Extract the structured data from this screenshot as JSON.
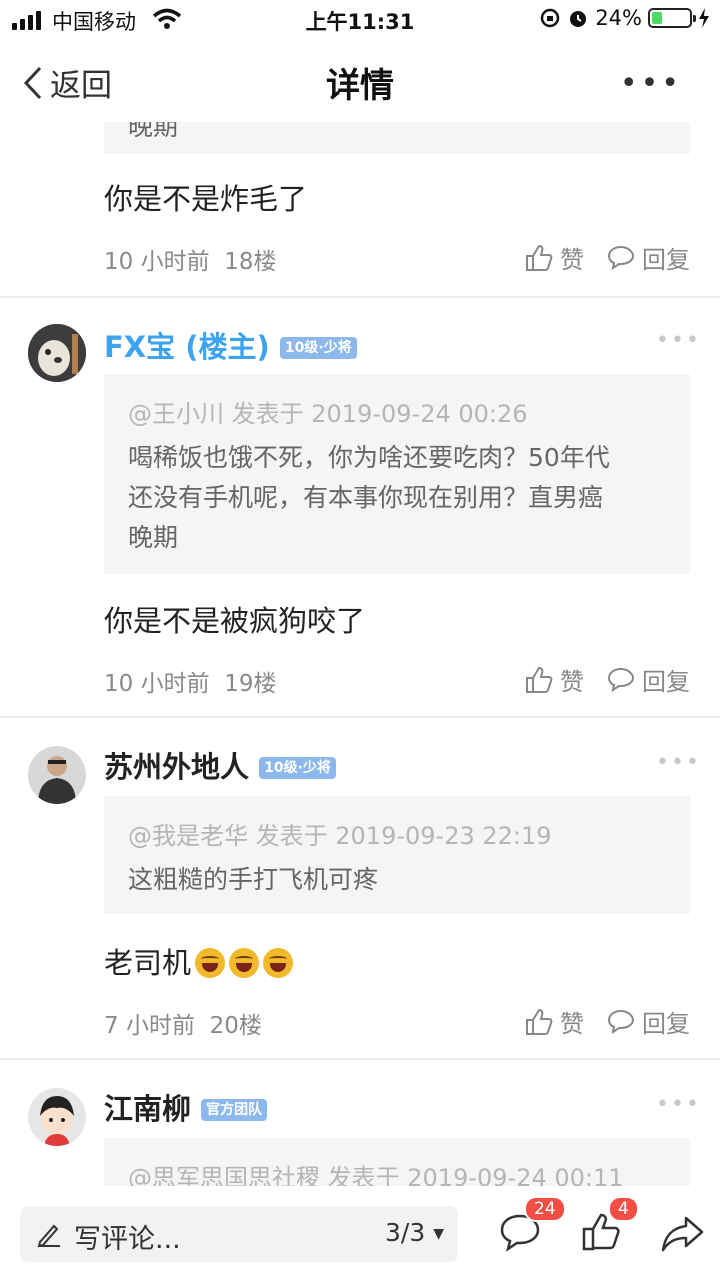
{
  "status": {
    "carrier": "中国移动",
    "time": "上午11:31",
    "battery": "24%"
  },
  "nav": {
    "back": "返回",
    "title": "详情",
    "more": "•••"
  },
  "top_fragment": {
    "quote_tail": "晚期",
    "content": "你是不是炸毛了",
    "time": "10 小时前",
    "floor": "18楼",
    "like": "赞",
    "reply": "回复"
  },
  "posts": [
    {
      "name": "FX宝 (楼主)",
      "badge": "10级·少将",
      "quote_meta": "@王小川 发表于 2019-09-24 00:26",
      "quote_line1": "喝稀饭也饿不死，你为啥还要吃肉？50年代",
      "quote_line2": "还没有手机呢，有本事你现在别用？直男癌",
      "quote_line3": "晚期",
      "content": "你是不是被疯狗咬了",
      "time": "10 小时前",
      "floor": "19楼",
      "like": "赞",
      "reply": "回复"
    },
    {
      "name": "苏州外地人",
      "badge": "10级·少将",
      "quote_meta": "@我是老华 发表于 2019-09-23 22:19",
      "quote_line1": "这粗糙的手打飞机可疼",
      "content": "老司机",
      "time": "7 小时前",
      "floor": "20楼",
      "like": "赞",
      "reply": "回复"
    },
    {
      "name": "江南柳",
      "badge": "官方团队",
      "quote_meta": "@思军思国思社稷 发表于 2019-09-24 00:11"
    }
  ],
  "bottom": {
    "placeholder": "写评论...",
    "page": "3/3",
    "comments": "24",
    "likes": "4"
  }
}
